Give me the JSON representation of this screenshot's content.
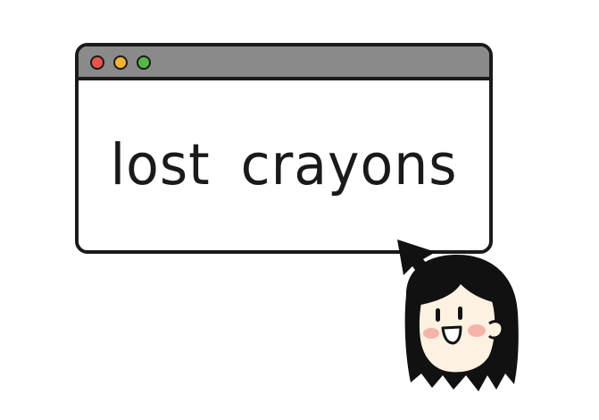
{
  "window": {
    "title_words": [
      "lost",
      "crayons"
    ]
  },
  "colors": {
    "close": "#e8534a",
    "minimize": "#f2b233",
    "maximize": "#55b847",
    "titlebar": "#8a8a8a",
    "outline": "#1a1a1a",
    "hair": "#111111",
    "skin": "#fdf1e2",
    "blush": "#f6b3a9"
  },
  "icons": {
    "pointer": "arrow-cursor-icon",
    "character": "girl-avatar"
  }
}
